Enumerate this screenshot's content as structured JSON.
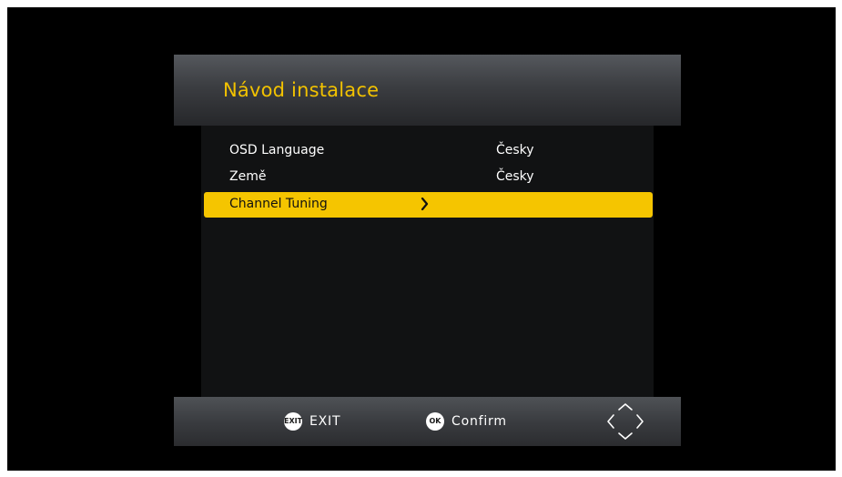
{
  "dialog": {
    "title": "Návod instalace"
  },
  "menu": {
    "items": [
      {
        "label": "OSD Language",
        "value": "Česky"
      },
      {
        "label": "Země",
        "value": "Česky"
      },
      {
        "label": "Channel Tuning",
        "value": ""
      }
    ],
    "selected_index": 2
  },
  "footer": {
    "exit": {
      "badge": "EXIT",
      "label": "EXIT"
    },
    "confirm": {
      "badge": "OK",
      "label": "Confirm"
    },
    "nav_icon": "arrow-keys-icon"
  },
  "colors": {
    "accent": "#f5c500",
    "title_color": "#f2c200",
    "background": "#000000"
  }
}
